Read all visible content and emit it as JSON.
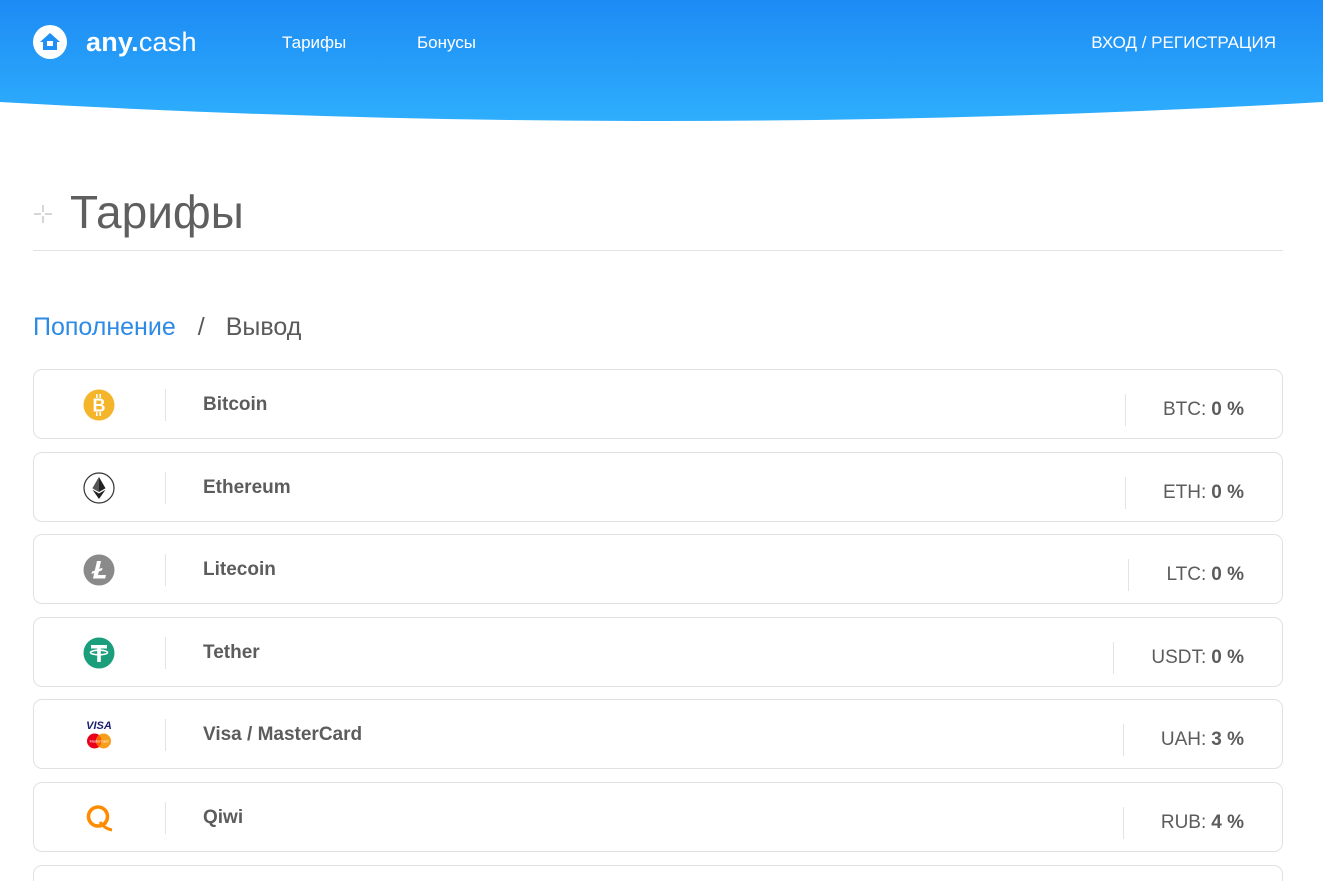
{
  "header": {
    "logo": {
      "brand_bold": "any.",
      "brand_light": "cash"
    },
    "nav": {
      "tariffs": "Тарифы",
      "bonuses": "Бонусы"
    },
    "login": "ВХОД / РЕГИСТРАЦИЯ",
    "colors": {
      "gradient_left": "#1e8ff6",
      "gradient_right": "#2aa8fb"
    }
  },
  "page": {
    "title": "Тарифы"
  },
  "tabs": {
    "active": "Пополнение",
    "separator": "/",
    "inactive": "Вывод"
  },
  "methods": [
    {
      "icon": "bitcoin-icon",
      "name": "Bitcoin",
      "currency": "BTC:",
      "fee": "0 %"
    },
    {
      "icon": "ethereum-icon",
      "name": "Ethereum",
      "currency": "ETH:",
      "fee": "0 %"
    },
    {
      "icon": "litecoin-icon",
      "name": "Litecoin",
      "currency": "LTC:",
      "fee": "0 %"
    },
    {
      "icon": "tether-icon",
      "name": "Tether",
      "currency": "USDT:",
      "fee": "0 %"
    },
    {
      "icon": "visa-mastercard-icon",
      "name": "Visa / MasterCard",
      "currency": "UAH:",
      "fee": "3 %",
      "icon_text": "VISA",
      "icon_subtext": "MasterCard"
    },
    {
      "icon": "qiwi-icon",
      "name": "Qiwi",
      "currency": "RUB:",
      "fee": "4 %"
    }
  ]
}
